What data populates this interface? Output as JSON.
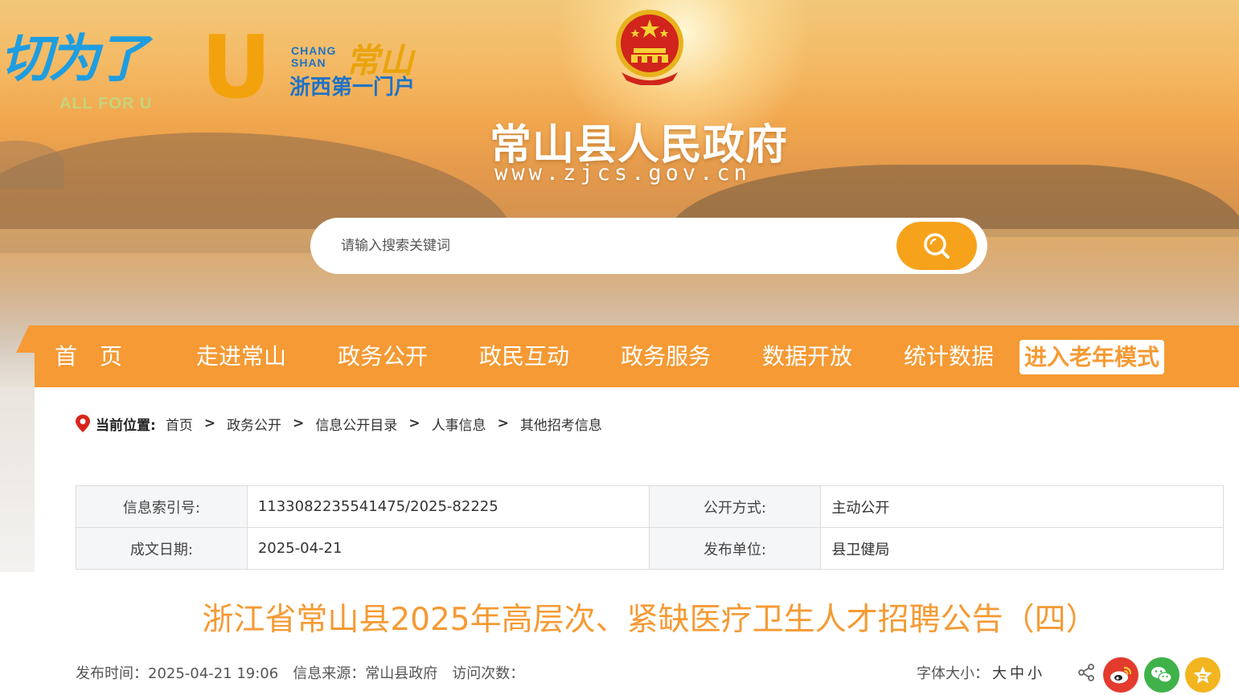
{
  "banner": {
    "slogan_cn": "切为了",
    "slogan_u": "U",
    "slogan_en": "ALL FOR U",
    "city_en_line1": "CHANG",
    "city_en_line2": "SHAN",
    "city_cn": "常山",
    "portal_tagline": "浙西第一门户",
    "site_title": "常山县人民政府",
    "site_url": "www.zjcs.gov.cn"
  },
  "search": {
    "placeholder": "请输入搜索关键词"
  },
  "nav": {
    "items": [
      "首　页",
      "走进常山",
      "政务公开",
      "政民互动",
      "政务服务",
      "数据开放",
      "统计数据"
    ],
    "elder_mode": "进入老年模式"
  },
  "breadcrumb": {
    "label": "当前位置:",
    "items": [
      "首页",
      "政务公开",
      "信息公开目录",
      "人事信息",
      "其他招考信息"
    ],
    "separator": ">"
  },
  "info": {
    "index_label": "信息索引号:",
    "index_value": "1133082235541475/2025-82225",
    "disclosure_label": "公开方式:",
    "disclosure_value": "主动公开",
    "date_label": "成文日期:",
    "date_value": "2025-04-21",
    "publisher_label": "发布单位:",
    "publisher_value": "县卫健局"
  },
  "article": {
    "title": "浙江省常山县2025年高层次、紧缺医疗卫生人才招聘公告（四）",
    "publish_time": "发布时间：2025-04-21 19:06",
    "source": "信息来源：常山县政府",
    "visits": "访问次数："
  },
  "font_size": {
    "label": "字体大小：",
    "large": "大",
    "medium": "中",
    "small": "小"
  },
  "colors": {
    "accent": "#f59a34",
    "search_button": "#f7a21b",
    "weibo": "#e33b2e",
    "wechat": "#3fb24a",
    "favorite": "#f3b51f"
  },
  "icons": [
    "search-icon",
    "location-pin-icon",
    "share-icon",
    "weibo-icon",
    "wechat-icon",
    "favorite-star-icon",
    "national-emblem"
  ]
}
